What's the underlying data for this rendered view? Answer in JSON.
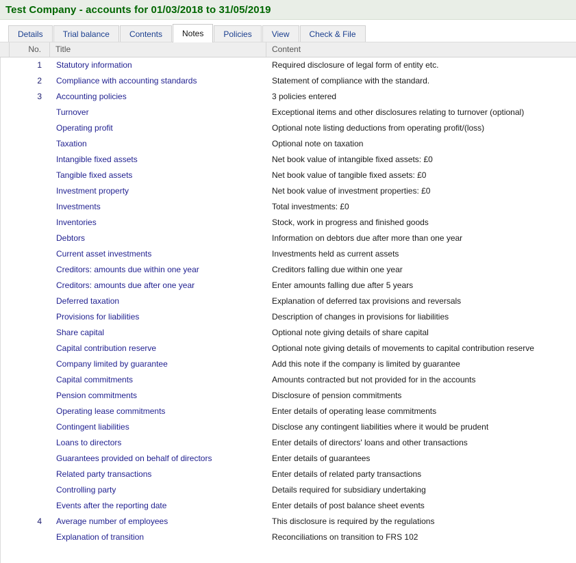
{
  "window": {
    "title": "Test Company - accounts for 01/03/2018 to 31/05/2019",
    "title_color": "#006600",
    "banner_bg": "#e9eee7"
  },
  "tabs": [
    {
      "label": "Details",
      "active": false
    },
    {
      "label": "Trial balance",
      "active": false
    },
    {
      "label": "Contents",
      "active": false
    },
    {
      "label": "Notes",
      "active": true
    },
    {
      "label": "Policies",
      "active": false
    },
    {
      "label": "View",
      "active": false
    },
    {
      "label": "Check & File",
      "active": false
    }
  ],
  "grid": {
    "columns": [
      {
        "key": "no",
        "label": "No."
      },
      {
        "key": "title",
        "label": "Title"
      },
      {
        "key": "content",
        "label": "Content"
      }
    ],
    "link_color": "#1f1f8f",
    "rows": [
      {
        "no": "1",
        "title": "Statutory information",
        "content": "Required disclosure of legal form of entity etc."
      },
      {
        "no": "2",
        "title": "Compliance with accounting standards",
        "content": "Statement of compliance with the standard."
      },
      {
        "no": "3",
        "title": "Accounting policies",
        "content": "3 policies entered"
      },
      {
        "no": "",
        "title": "Turnover",
        "content": "Exceptional items and other disclosures relating to turnover (optional)"
      },
      {
        "no": "",
        "title": "Operating profit",
        "content": "Optional note listing deductions from operating profit/(loss)"
      },
      {
        "no": "",
        "title": "Taxation",
        "content": "Optional note on taxation"
      },
      {
        "no": "",
        "title": "Intangible fixed assets",
        "content": "Net book value of intangible fixed assets: £0"
      },
      {
        "no": "",
        "title": "Tangible fixed assets",
        "content": "Net book value of tangible fixed assets: £0"
      },
      {
        "no": "",
        "title": "Investment property",
        "content": "Net book value of investment properties: £0"
      },
      {
        "no": "",
        "title": "Investments",
        "content": "Total investments: £0"
      },
      {
        "no": "",
        "title": "Inventories",
        "content": "Stock, work in progress and finished goods"
      },
      {
        "no": "",
        "title": "Debtors",
        "content": "Information on debtors due after more than one year"
      },
      {
        "no": "",
        "title": "Current asset investments",
        "content": "Investments held as current assets"
      },
      {
        "no": "",
        "title": "Creditors: amounts due within one year",
        "content": "Creditors falling due within one year"
      },
      {
        "no": "",
        "title": "Creditors: amounts due after one year",
        "content": "Enter amounts falling due after 5 years"
      },
      {
        "no": "",
        "title": "Deferred taxation",
        "content": "Explanation of deferred tax provisions and reversals"
      },
      {
        "no": "",
        "title": "Provisions for liabilities",
        "content": "Description of changes in provisions for liabilities"
      },
      {
        "no": "",
        "title": "Share capital",
        "content": "Optional note giving details of share capital"
      },
      {
        "no": "",
        "title": "Capital contribution reserve",
        "content": "Optional note giving details of movements to capital contribution reserve"
      },
      {
        "no": "",
        "title": "Company limited by guarantee",
        "content": "Add this note if the company is limited by guarantee"
      },
      {
        "no": "",
        "title": "Capital commitments",
        "content": "Amounts contracted but not provided for in the accounts"
      },
      {
        "no": "",
        "title": "Pension commitments",
        "content": "Disclosure of pension commitments"
      },
      {
        "no": "",
        "title": "Operating lease commitments",
        "content": "Enter details of operating lease commitments"
      },
      {
        "no": "",
        "title": "Contingent liabilities",
        "content": "Disclose any contingent liabilities where it would be prudent"
      },
      {
        "no": "",
        "title": "Loans to directors",
        "content": "Enter details of directors' loans and other transactions"
      },
      {
        "no": "",
        "title": "Guarantees provided on behalf of directors",
        "content": "Enter details of guarantees"
      },
      {
        "no": "",
        "title": "Related party transactions",
        "content": "Enter details of related party transactions"
      },
      {
        "no": "",
        "title": "Controlling party",
        "content": "Details required for subsidiary undertaking"
      },
      {
        "no": "",
        "title": "Events after the reporting date",
        "content": "Enter details of post balance sheet events"
      },
      {
        "no": "4",
        "title": "Average number of employees",
        "content": "This disclosure is required by the regulations"
      },
      {
        "no": "",
        "title": "Explanation of transition",
        "content": "Reconciliations on transition to FRS 102"
      }
    ]
  }
}
